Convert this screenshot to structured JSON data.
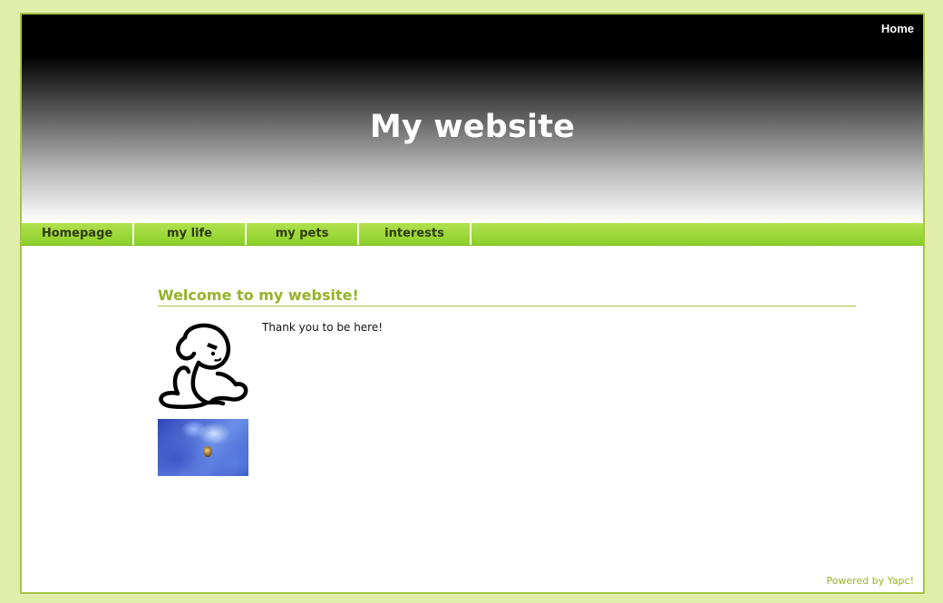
{
  "header": {
    "home_link": "Home",
    "site_title": "My website"
  },
  "nav": {
    "items": [
      {
        "label": "Homepage"
      },
      {
        "label": "my life"
      },
      {
        "label": "my pets"
      },
      {
        "label": "interests"
      }
    ]
  },
  "main": {
    "heading": "Welcome to my website!",
    "text": "Thank you to be here!",
    "images": [
      {
        "icon": "cartoon-figure-image"
      },
      {
        "icon": "blue-flower-photo"
      }
    ]
  },
  "footer": {
    "powered_by": "Powered by Yapc!"
  },
  "colors": {
    "page_bg": "#e1eeaa",
    "accent_green": "#94b42a",
    "nav_green": "#8cd02a",
    "frame_border": "#a6c447"
  }
}
